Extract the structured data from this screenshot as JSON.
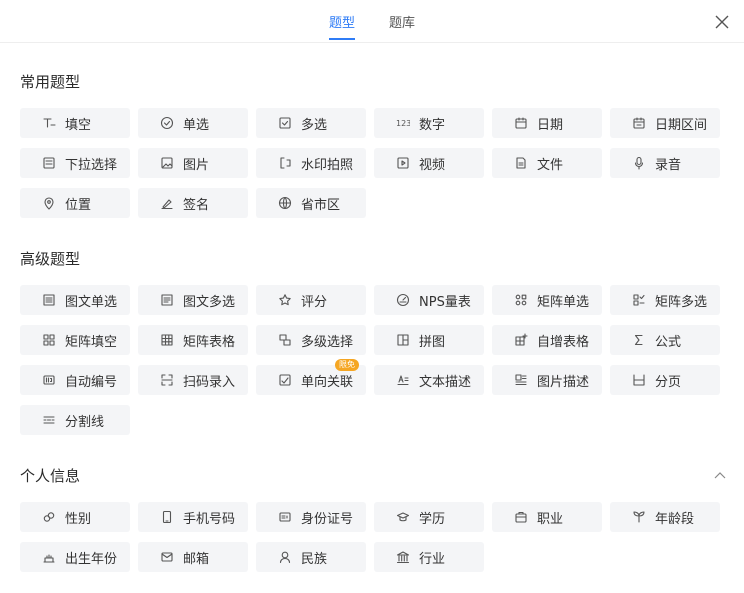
{
  "header": {
    "tabs": [
      {
        "label": "题型",
        "active": true
      },
      {
        "label": "题库",
        "active": false
      }
    ],
    "close_icon": "close-icon"
  },
  "sections": {
    "common": {
      "title": "常用题型",
      "items": [
        {
          "label": "填空",
          "icon": "text-cursor-icon"
        },
        {
          "label": "单选",
          "icon": "check-circle-icon"
        },
        {
          "label": "多选",
          "icon": "check-square-icon"
        },
        {
          "label": "数字",
          "icon": "number-icon"
        },
        {
          "label": "日期",
          "icon": "calendar-icon"
        },
        {
          "label": "日期区间",
          "icon": "calendar-range-icon"
        },
        {
          "label": "下拉选择",
          "icon": "dropdown-icon"
        },
        {
          "label": "图片",
          "icon": "image-icon"
        },
        {
          "label": "水印拍照",
          "icon": "watermark-photo-icon"
        },
        {
          "label": "视频",
          "icon": "video-icon"
        },
        {
          "label": "文件",
          "icon": "file-icon"
        },
        {
          "label": "录音",
          "icon": "microphone-icon"
        },
        {
          "label": "位置",
          "icon": "location-pin-icon"
        },
        {
          "label": "签名",
          "icon": "signature-pen-icon"
        },
        {
          "label": "省市区",
          "icon": "globe-icon"
        }
      ]
    },
    "advanced": {
      "title": "高级题型",
      "items": [
        {
          "label": "图文单选",
          "icon": "image-text-single-icon"
        },
        {
          "label": "图文多选",
          "icon": "image-text-multi-icon"
        },
        {
          "label": "评分",
          "icon": "star-icon"
        },
        {
          "label": "NPS量表",
          "icon": "gauge-icon"
        },
        {
          "label": "矩阵单选",
          "icon": "matrix-single-icon"
        },
        {
          "label": "矩阵多选",
          "icon": "matrix-multi-icon"
        },
        {
          "label": "矩阵填空",
          "icon": "matrix-fill-icon"
        },
        {
          "label": "矩阵表格",
          "icon": "table-icon"
        },
        {
          "label": "多级选择",
          "icon": "cascade-icon"
        },
        {
          "label": "拼图",
          "icon": "puzzle-layout-icon"
        },
        {
          "label": "自增表格",
          "icon": "table-add-icon"
        },
        {
          "label": "公式",
          "icon": "sigma-icon"
        },
        {
          "label": "自动编号",
          "icon": "id-number-icon"
        },
        {
          "label": "扫码录入",
          "icon": "scan-icon"
        },
        {
          "label": "单向关联",
          "icon": "link-check-icon",
          "badge": "限免"
        },
        {
          "label": "文本描述",
          "icon": "text-desc-icon"
        },
        {
          "label": "图片描述",
          "icon": "image-desc-icon"
        },
        {
          "label": "分页",
          "icon": "page-break-icon"
        },
        {
          "label": "分割线",
          "icon": "divider-icon"
        }
      ]
    },
    "personal": {
      "title": "个人信息",
      "collapse_icon": "chevron-up-icon",
      "items": [
        {
          "label": "性别",
          "icon": "gender-icon"
        },
        {
          "label": "手机号码",
          "icon": "phone-icon"
        },
        {
          "label": "身份证号",
          "icon": "id-card-icon"
        },
        {
          "label": "学历",
          "icon": "graduation-cap-icon"
        },
        {
          "label": "职业",
          "icon": "briefcase-icon"
        },
        {
          "label": "年龄段",
          "icon": "sprout-icon"
        },
        {
          "label": "出生年份",
          "icon": "cake-icon"
        },
        {
          "label": "邮箱",
          "icon": "mail-icon"
        },
        {
          "label": "民族",
          "icon": "person-icon"
        },
        {
          "label": "行业",
          "icon": "bank-icon"
        }
      ]
    }
  },
  "colors": {
    "accent": "#2f7cf6",
    "badge": "#f5a623",
    "tile_bg": "#f4f5f7"
  }
}
